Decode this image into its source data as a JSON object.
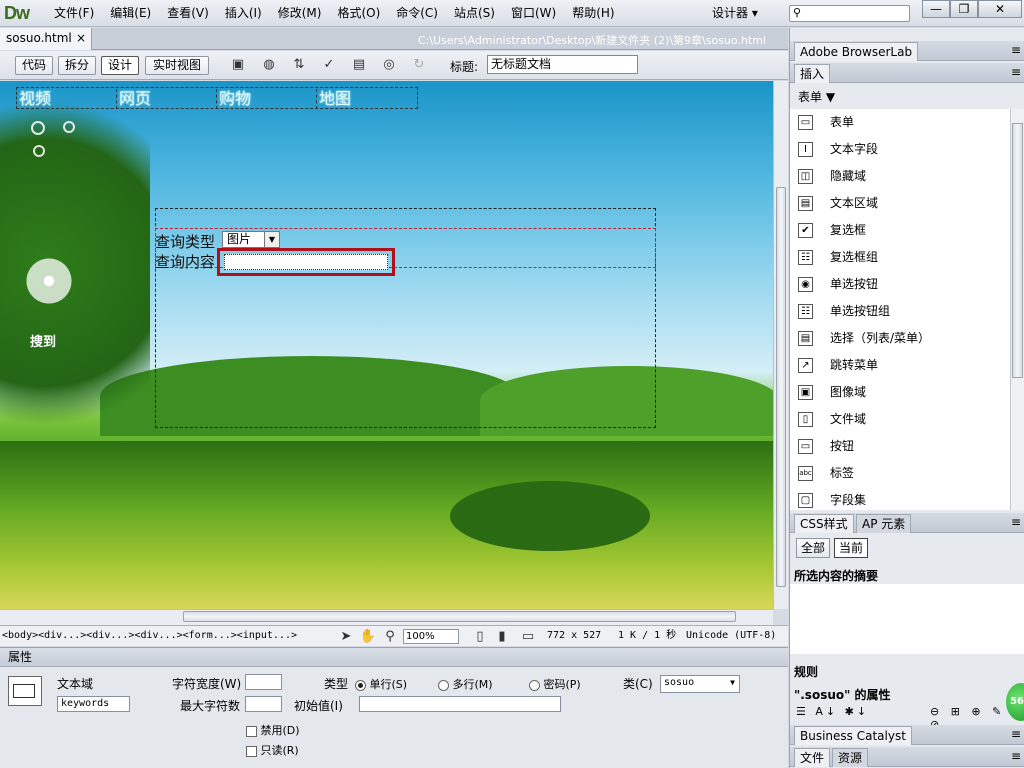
{
  "app": {
    "logo": "Dw",
    "workspace": "设计器 ▾"
  },
  "menu": [
    "文件(F)",
    "编辑(E)",
    "查看(V)",
    "插入(I)",
    "修改(M)",
    "格式(O)",
    "命令(C)",
    "站点(S)",
    "窗口(W)",
    "帮助(H)"
  ],
  "window": {
    "minimize": "—",
    "restore": "❐",
    "close": "✕"
  },
  "document": {
    "tab": "sosuo.html",
    "tab_close": "×",
    "path": "C:\\Users\\Administrator\\Desktop\\新建文件夹 (2)\\第9章\\sosuo.html"
  },
  "toolbar": {
    "code": "代码",
    "split": "拆分",
    "design": "设计",
    "live": "实时视图",
    "title_label": "标题:",
    "title_value": "无标题文档"
  },
  "page": {
    "nav": [
      "视频",
      "网页",
      "购物",
      "地图"
    ],
    "logo_text": "搜到",
    "query_type_label": "查询类型",
    "query_type_value": "图片",
    "query_content_label": "查询内容"
  },
  "status": {
    "tags": "<body><div...><div...><div...><form...><input...>",
    "zoom": "100%",
    "size": "772 x 527",
    "weight": "1 K / 1 秒",
    "encoding": "Unicode (UTF-8)"
  },
  "properties": {
    "header": "属性",
    "field_type": "文本域",
    "field_name": "keywords",
    "char_width": "字符宽度(W)",
    "max_chars": "最大字符数",
    "type_label": "类型",
    "single": "单行(S)",
    "multi": "多行(M)",
    "password": "密码(P)",
    "init_value": "初始值(I)",
    "class_label": "类(C)",
    "class_value": "sosuo",
    "disabled": "禁用(D)",
    "readonly": "只读(R)"
  },
  "panels": {
    "browserlab": "Adobe BrowserLab",
    "insert_tab": "插入",
    "category": "表单",
    "items": [
      {
        "icon": "▭",
        "label": "表单"
      },
      {
        "icon": "I",
        "label": "文本字段"
      },
      {
        "icon": "◫",
        "label": "隐藏域"
      },
      {
        "icon": "▤",
        "label": "文本区域"
      },
      {
        "icon": "✔",
        "label": "复选框"
      },
      {
        "icon": "☷",
        "label": "复选框组"
      },
      {
        "icon": "◉",
        "label": "单选按钮"
      },
      {
        "icon": "☷",
        "label": "单选按钮组"
      },
      {
        "icon": "▤",
        "label": "选择（列表/菜单）"
      },
      {
        "icon": "↗",
        "label": "跳转菜单"
      },
      {
        "icon": "▣",
        "label": "图像域"
      },
      {
        "icon": "▯",
        "label": "文件域"
      },
      {
        "icon": "▭",
        "label": "按钮"
      },
      {
        "icon": "abc",
        "label": "标签"
      },
      {
        "icon": "▢",
        "label": "字段集"
      }
    ],
    "css_tab": "CSS样式",
    "ap_tab": "AP 元素",
    "all": "全部",
    "current": "当前",
    "summary": "所选内容的摘要",
    "rules": "规则",
    "props_of": "\".sosuo\" 的属性",
    "business": "Business Catalyst",
    "files_tab": "文件",
    "assets_tab": "资源",
    "badge": "56"
  }
}
